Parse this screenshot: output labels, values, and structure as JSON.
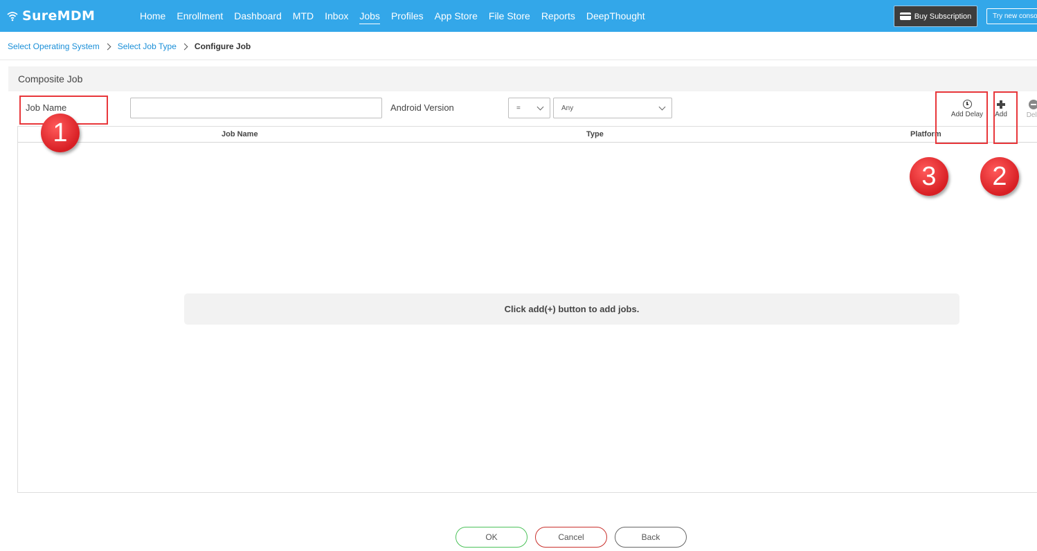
{
  "app": {
    "brand": "SureMDM",
    "nav": [
      "Home",
      "Enrollment",
      "Dashboard",
      "MTD",
      "Inbox",
      "Jobs",
      "Profiles",
      "App Store",
      "File Store",
      "Reports",
      "DeepThought"
    ],
    "active_nav": "Jobs",
    "buy_label": "Buy Subscription",
    "try_label": "Try new conso"
  },
  "breadcrumb": {
    "step1": "Select Operating System",
    "step2": "Select Job Type",
    "current": "Configure Job"
  },
  "panel": {
    "title": "Composite Job"
  },
  "form": {
    "job_name_label": "Job Name",
    "job_name_value": "",
    "android_version_label": "Android Version",
    "operator_value": "=",
    "version_value": "Any"
  },
  "toolbar": {
    "add_delay_label": "Add Delay",
    "add_label": "Add",
    "delete_label": "Dele"
  },
  "table": {
    "columns": [
      "Job Name",
      "Type",
      "Platform"
    ],
    "empty_message": "Click add(+) button to add jobs."
  },
  "footer": {
    "ok_label": "OK",
    "cancel_label": "Cancel",
    "back_label": "Back"
  },
  "annotations": [
    "1",
    "3",
    "2"
  ],
  "colors": {
    "topbar": "#33a7e9",
    "annotation": "#e8363a",
    "ok": "#4cc25a",
    "cancel": "#c9302c"
  }
}
